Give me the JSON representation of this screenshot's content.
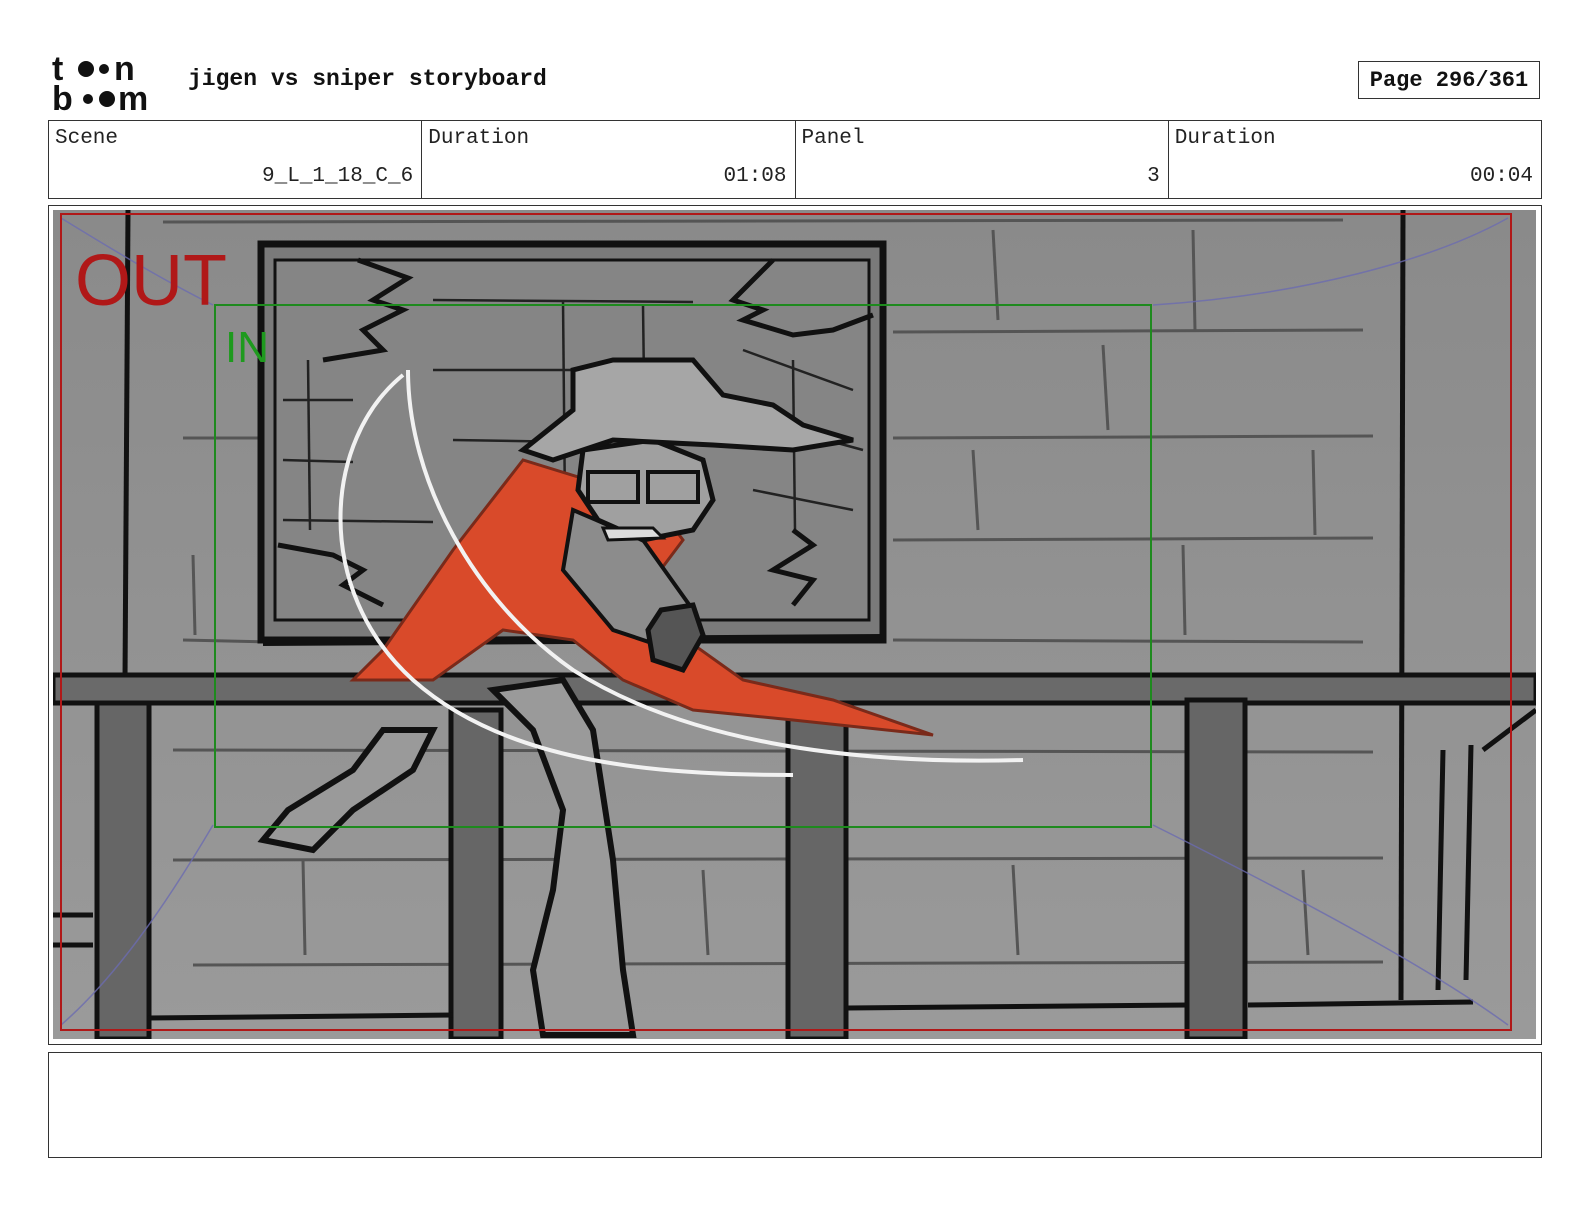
{
  "header": {
    "logo_text": "toonboom",
    "title": "jigen vs sniper storyboard",
    "page_label": "Page 296/361"
  },
  "info": {
    "scene_label": "Scene",
    "scene_value": "9_L_1_18_C_6",
    "scene_duration_label": "Duration",
    "scene_duration_value": "01:08",
    "panel_label": "Panel",
    "panel_value": "3",
    "panel_duration_label": "Duration",
    "panel_duration_value": "00:04"
  },
  "panel": {
    "out_label": "OUT",
    "in_label": "IN",
    "colors": {
      "out_frame": "#b01818",
      "in_frame": "#1e8a1e",
      "cape": "#d94a2a",
      "safe_lines": "#6b6bb0",
      "slash": "#f2f2f2"
    }
  },
  "notes": {
    "text": ""
  }
}
